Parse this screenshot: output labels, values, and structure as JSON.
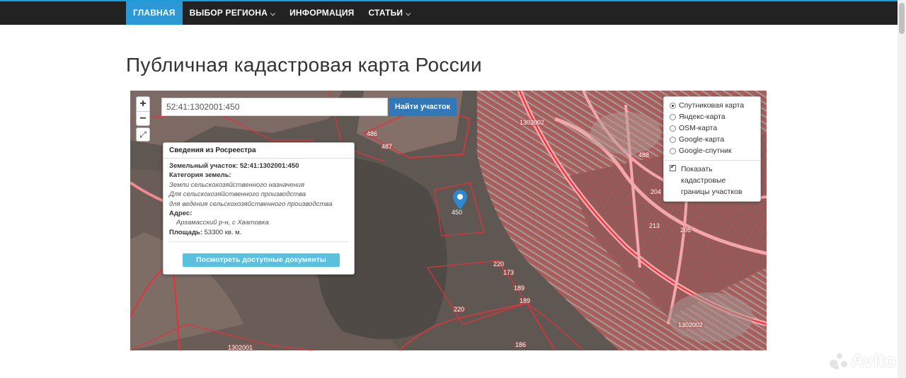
{
  "nav": {
    "items": [
      {
        "label": "ГЛАВНАЯ",
        "active": true
      },
      {
        "label": "ВЫБОР РЕГИОНА",
        "dropdown": true
      },
      {
        "label": "ИНФОРМАЦИЯ"
      },
      {
        "label": "СТАТЬИ",
        "dropdown": true
      }
    ]
  },
  "page": {
    "title": "Публичная кадастровая карта России"
  },
  "map": {
    "zoom_in": "+",
    "zoom_out": "−",
    "search": {
      "value": "52:41:1302001:450"
    },
    "search_button": "Найти участок",
    "info": {
      "header": "Сведения из Росреестра",
      "plot_label": "Земельный участок:",
      "plot_value": "52:41:1302001:450",
      "category_label": "Категория земель:",
      "category_lines": [
        "Земли сельскохозяйственного назначения",
        "Для сельскохозяйственного производства",
        "для ведения сельскохозяйственного производства"
      ],
      "address_label": "Адрес:",
      "address_value": "Арзамасский р-н, с Хватовка",
      "area_label": "Площадь:",
      "area_value": "53300 кв. м.",
      "docs_button": "Посмотреть доступные документы"
    },
    "layers": {
      "options": [
        {
          "label": "Спутниковая карта",
          "selected": true
        },
        {
          "label": "Яндекс-карта",
          "selected": false
        },
        {
          "label": "OSM-карта",
          "selected": false
        },
        {
          "label": "Google-карта",
          "selected": false
        },
        {
          "label": "Google-спутник",
          "selected": false
        }
      ],
      "show_boundaries": {
        "label": "Показать кадастровые границы участков",
        "checked": true
      }
    },
    "plot_labels": [
      "1302002",
      "486",
      "487",
      "450",
      "488",
      "204",
      "213",
      "205",
      "220",
      "173",
      "189",
      "189",
      "220",
      "1302002",
      "1302001",
      "186"
    ],
    "pin_label": "450"
  },
  "watermark": "Avito",
  "colors": {
    "accent": "#2c98d4",
    "navbar": "#222222",
    "boundary": "#e8303a",
    "docs_button": "#5bc0de"
  }
}
